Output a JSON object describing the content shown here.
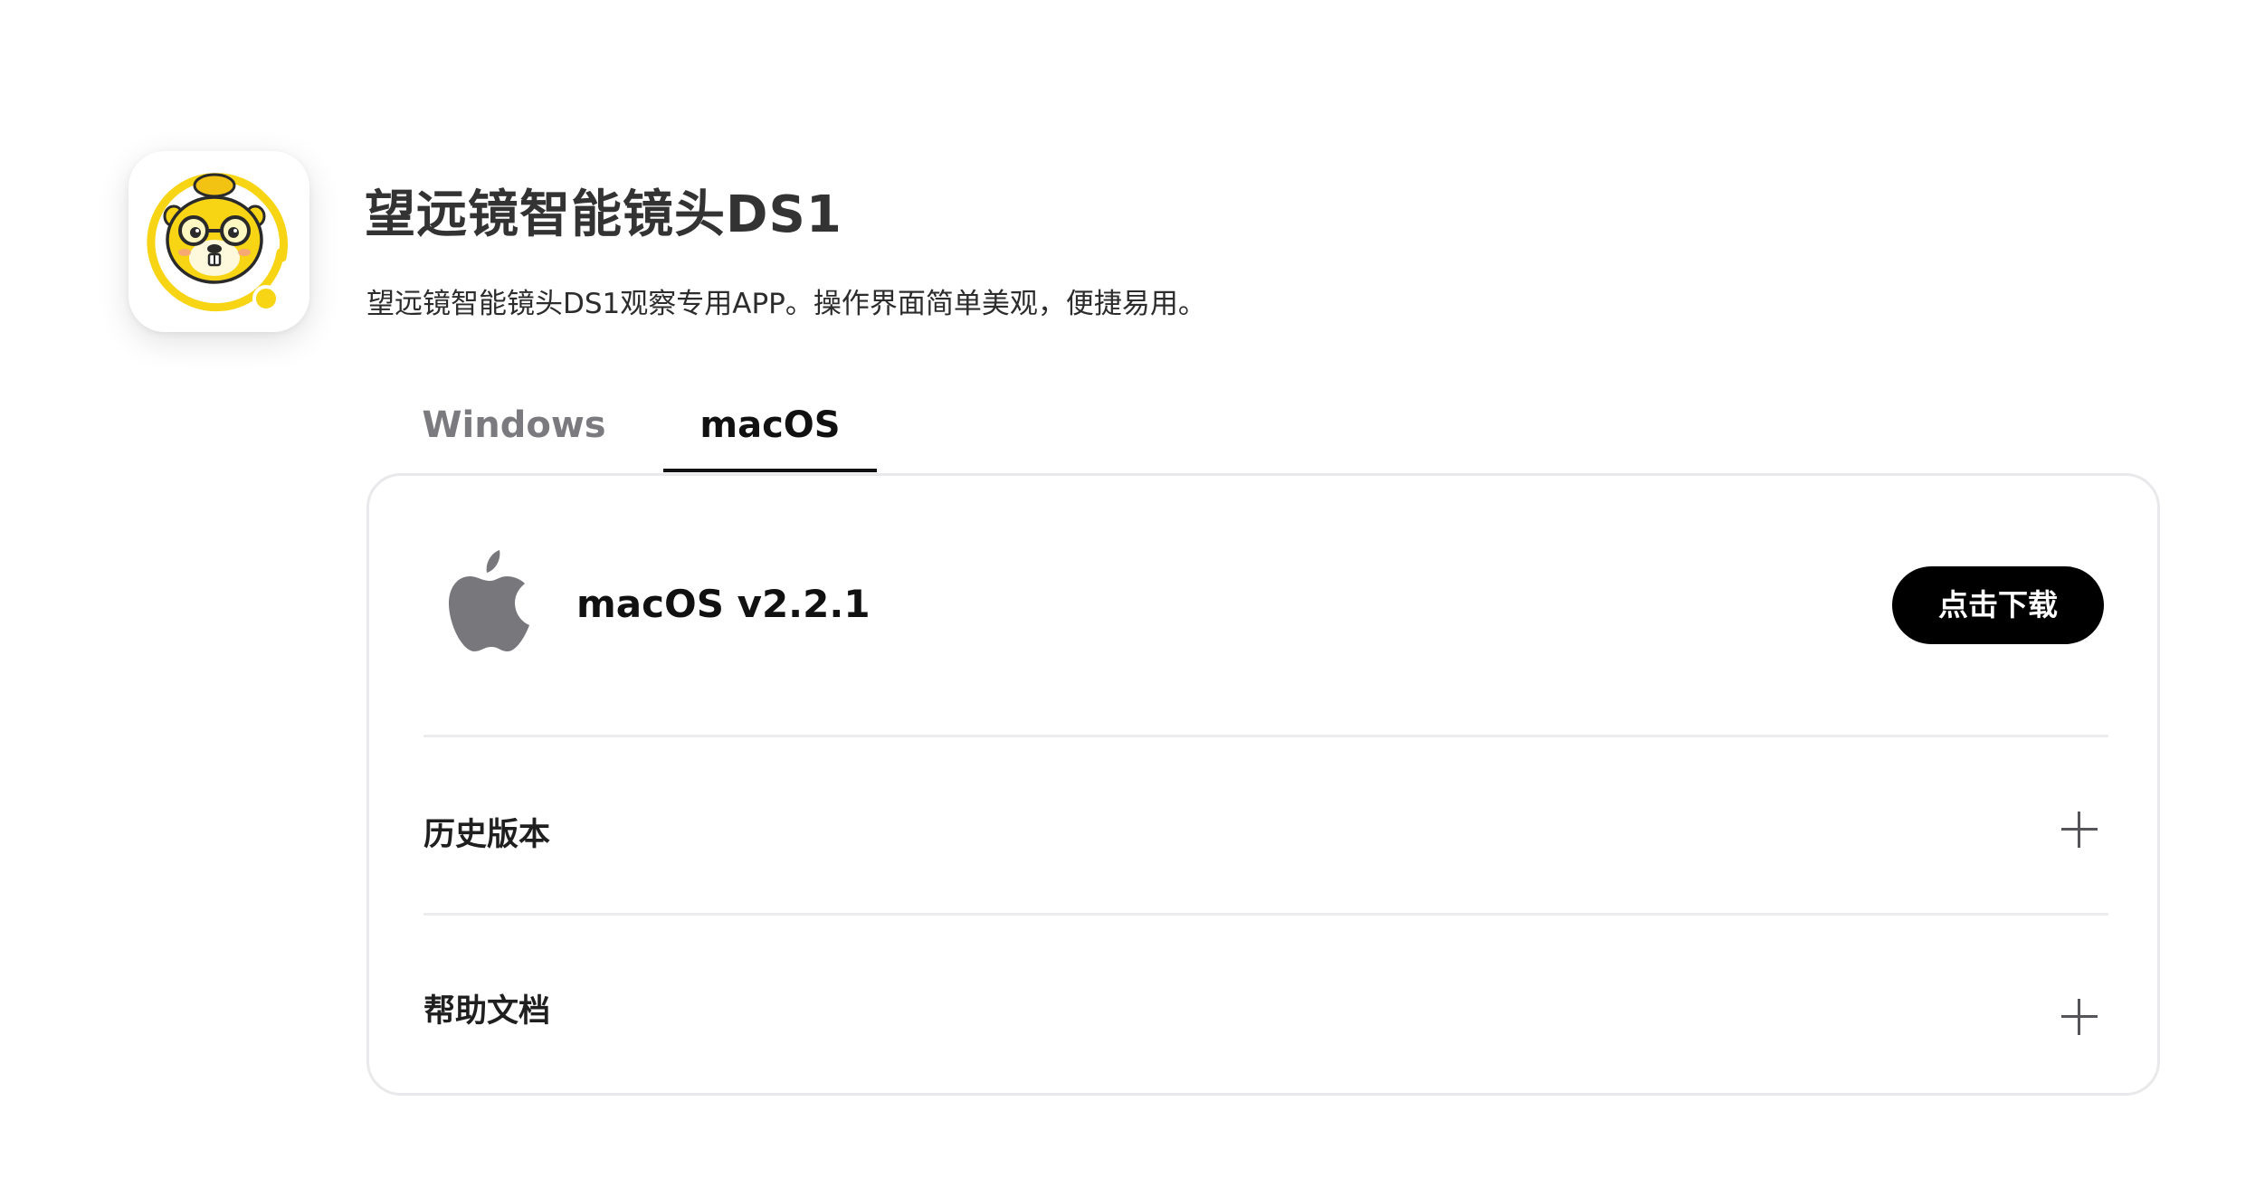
{
  "app": {
    "title": "望远镜智能镜头DS1",
    "description": "望远镜智能镜头DS1观察专用APP。操作界面简单美观，便捷易用。",
    "icon": "beaver-mascot-icon"
  },
  "tabs": [
    {
      "label": "Windows",
      "active": false
    },
    {
      "label": "macOS",
      "active": true
    }
  ],
  "download": {
    "platform_icon": "apple-icon",
    "version_label": "macOS v2.2.1",
    "button_label": "点击下载"
  },
  "sections": [
    {
      "label": "历史版本",
      "icon": "plus-icon"
    },
    {
      "label": "帮助文档",
      "icon": "plus-icon"
    }
  ],
  "colors": {
    "accent_yellow": "#f7d414",
    "button_bg": "#000000",
    "inactive_tab": "#7b7b7f",
    "apple_gray": "#77777c"
  }
}
